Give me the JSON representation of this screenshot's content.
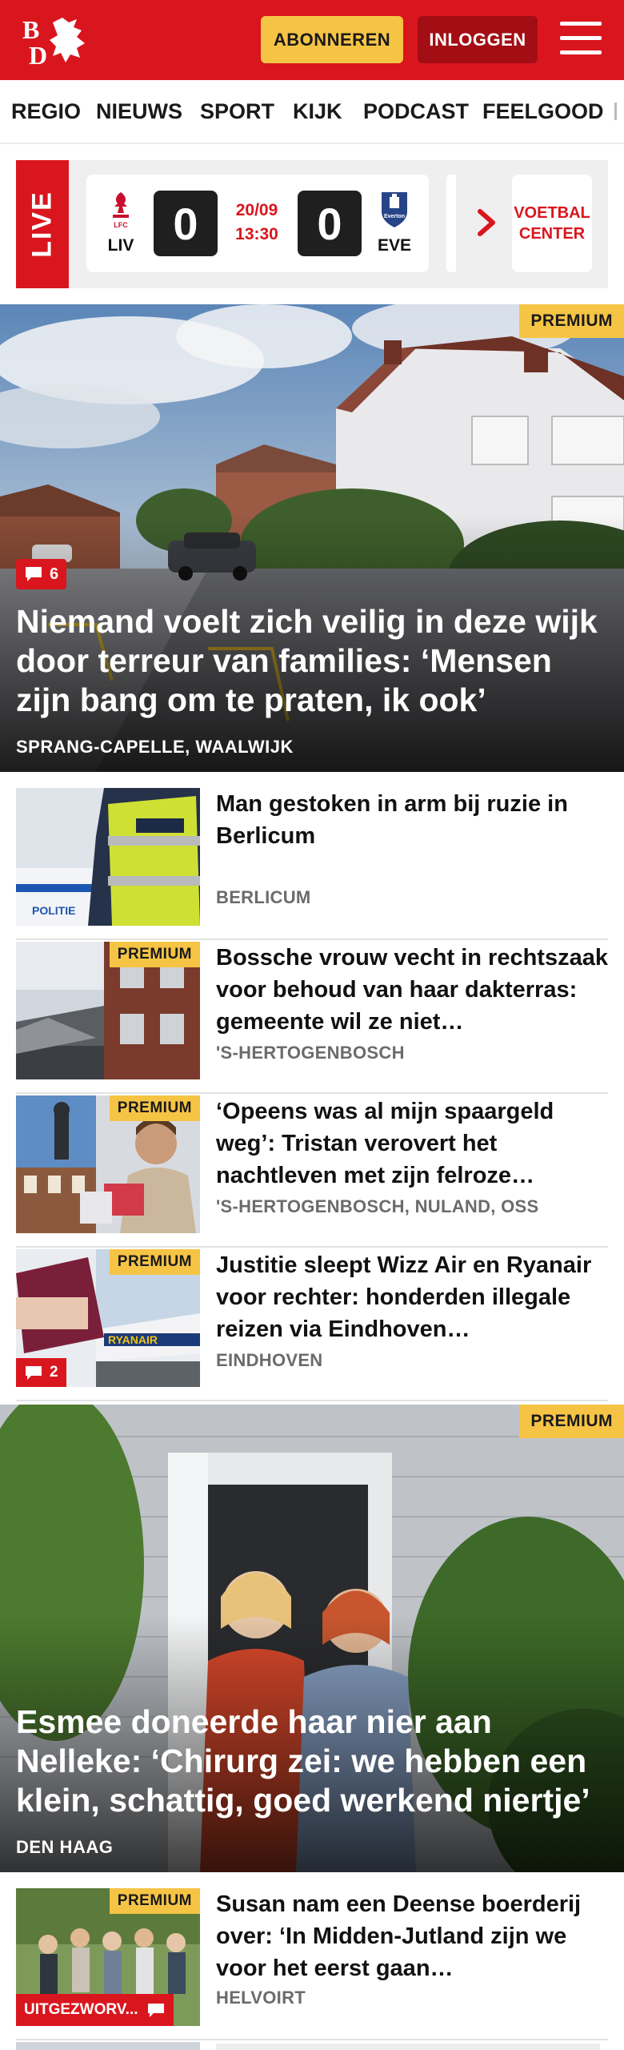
{
  "header": {
    "logo_text": "BD",
    "subscribe_label": "ABONNEREN",
    "login_label": "INLOGGEN",
    "menu_icon": "hamburger-icon",
    "brand_color": "#d9161e",
    "accent_color": "#f6c445"
  },
  "nav": {
    "items": [
      "REGIO",
      "NIEUWS",
      "SPORT",
      "KIJK",
      "PODCAST",
      "FEELGOOD"
    ]
  },
  "live": {
    "label": "LIVE",
    "match": {
      "home_abbr": "LIV",
      "away_abbr": "EVE",
      "home_score": "0",
      "away_score": "0",
      "date": "20/09",
      "time": "13:30",
      "home_crest_icon": "liverpool-crest-icon",
      "away_crest_icon": "everton-crest-icon"
    },
    "voetbal_center_label": "VOETBAL CENTER"
  },
  "hero1": {
    "premium_label": "PREMIUM",
    "comment_count": "6",
    "title": "Niemand voelt zich veilig in deze wijk door terreur van families: ‘Mensen zijn bang om te praten, ik ook’",
    "location": "SPRANG-CAPELLE, WAALWIJK"
  },
  "articles": [
    {
      "title": "Man gestoken in arm bij ruzie in Berlicum",
      "location": "BERLICUM",
      "premium": false
    },
    {
      "title": "Bossche vrouw vecht in rechtszaak voor behoud van haar dakterras: gemeente wil ze niet…",
      "location": "'S-HERTOGENBOSCH",
      "premium_label": "PREMIUM"
    },
    {
      "title": "‘Opeens was al mijn spaargeld weg’: Tristan verovert het nachtleven met zijn felroze…",
      "location": "'S-HERTOGENBOSCH, NULAND, OSS",
      "premium_label": "PREMIUM"
    },
    {
      "title": "Justitie sleept Wizz Air en Ryanair voor rechter: honderden illegale reizen via Eindhoven…",
      "location": "EINDHOVEN",
      "premium_label": "PREMIUM",
      "comment_count": "2"
    }
  ],
  "hero2": {
    "premium_label": "PREMIUM",
    "title": "Esmee doneerde haar nier aan Nelleke: ‘Chirurg zei: we hebben een klein, schattig, goed werkend niertje’",
    "location": "DEN HAAG"
  },
  "article5": {
    "title": "Susan nam een Deense boerderij over: ‘In Midden-Jutland zijn we voor het eerst gaan…",
    "location": "HELVOIRT",
    "premium_label": "PREMIUM",
    "label": "UITGEZWORV..."
  }
}
